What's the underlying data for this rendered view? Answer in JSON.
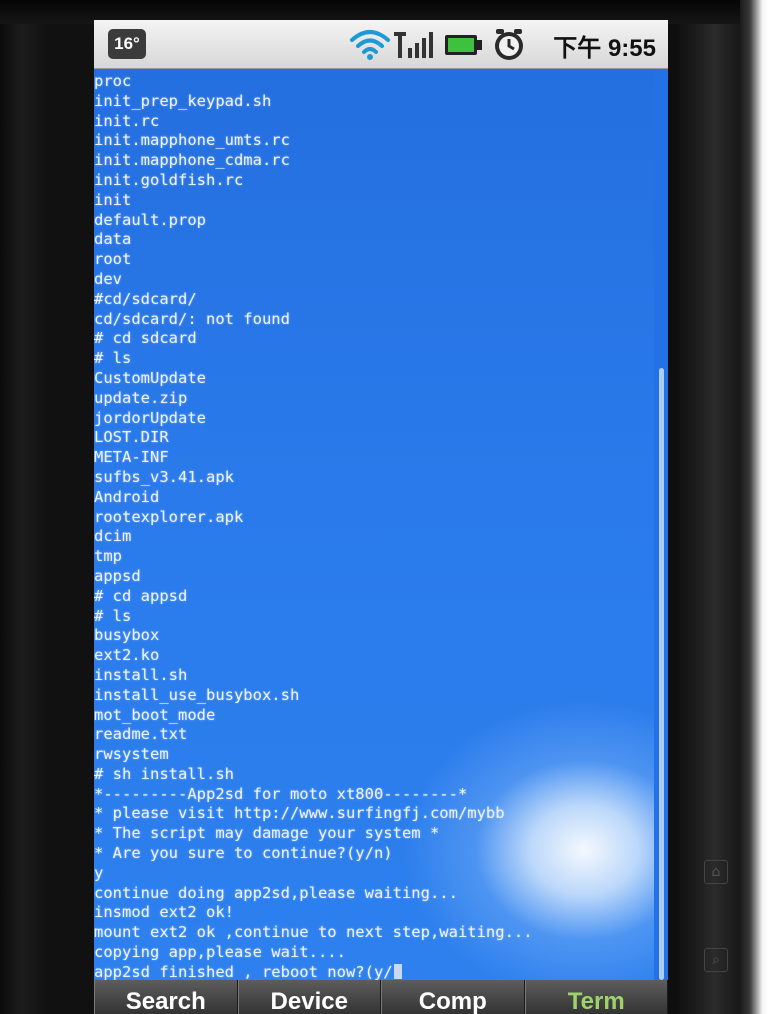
{
  "status_bar": {
    "temperature": "16°",
    "time": "下午 9:55",
    "icons": [
      "wifi-icon",
      "signal-icon",
      "battery-icon",
      "alarm-icon"
    ],
    "battery_color": "#3ec13e"
  },
  "terminal": {
    "background_color": "#2272e6",
    "text_color": "#eef4ff",
    "lines": [
      "proc",
      "init_prep_keypad.sh",
      "init.rc",
      "init.mapphone_umts.rc",
      "init.mapphone_cdma.rc",
      "init.goldfish.rc",
      "init",
      "default.prop",
      "data",
      "root",
      "dev",
      "#cd/sdcard/",
      "cd/sdcard/: not found",
      "# cd sdcard",
      "# ls",
      "CustomUpdate",
      "update.zip",
      "jordorUpdate",
      "LOST.DIR",
      "META-INF",
      "sufbs_v3.41.apk",
      "Android",
      "rootexplorer.apk",
      "dcim",
      "tmp",
      "appsd",
      "# cd appsd",
      "# ls",
      "busybox",
      "ext2.ko",
      "install.sh",
      "install_use_busybox.sh",
      "mot_boot_mode",
      "readme.txt",
      "rwsystem",
      "# sh install.sh",
      "*---------App2sd for moto xt800--------*",
      "*  please visit http://www.surfingfj.com/mybb",
      "*  The script may damage your system    *",
      "*  Are you sure to continue?(y/n)",
      "y",
      "continue doing app2sd,please waiting...",
      "insmod ext2 ok!",
      "mount ext2 ok ,continue to next step,waiting...",
      "copying app,please wait....",
      "app2sd finished , reboot now?(y/"
    ]
  },
  "softkeys": [
    "Search",
    "Device",
    "Comp",
    "Term"
  ],
  "softkey_accent_color": "#9ed36b"
}
